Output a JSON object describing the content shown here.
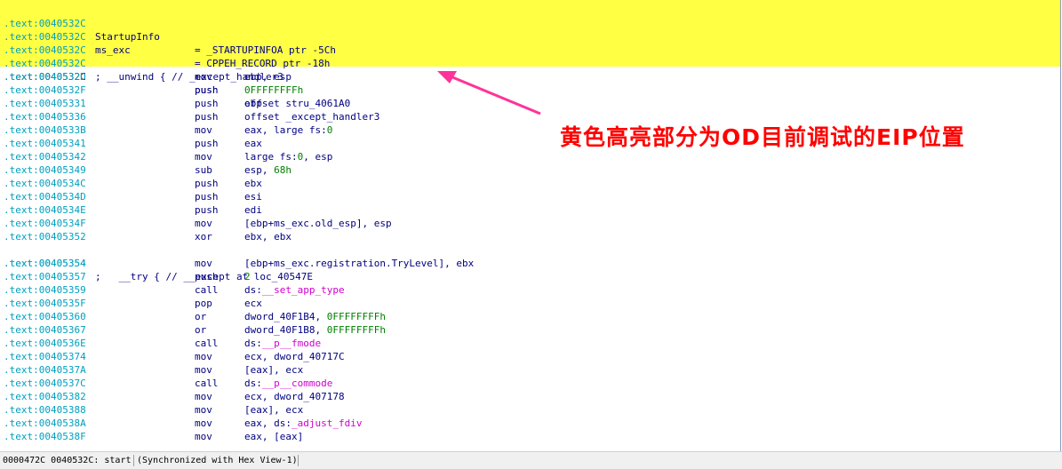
{
  "colors": {
    "highlight": "#ffff44",
    "address": "#00a0c0",
    "text": "#000080",
    "number": "#008000",
    "import": "#d000d0",
    "annotation": "#ff0000"
  },
  "listing": {
    "decls": [
      {
        "addr": ".text:0040532C",
        "name": "StartupInfo",
        "def": "= _STARTUPINFOA ptr -5Ch"
      },
      {
        "addr": ".text:0040532C",
        "name": "ms_exc",
        "def": "= CPPEH_RECORD ptr -18h"
      }
    ],
    "blank1": ".text:0040532C",
    "unwind": {
      "addr": ".text:0040532C",
      "comment": "; __unwind { // _except_handler3"
    },
    "current": {
      "addr": ".text:0040532C",
      "mnem": "push",
      "ops": "ebp"
    },
    "rows": [
      {
        "addr": ".text:0040532D",
        "mnem": "mov",
        "ops": "ebp, esp"
      },
      {
        "addr": ".text:0040532F",
        "mnem": "push",
        "ops": "0FFFFFFFFh"
      },
      {
        "addr": ".text:00405331",
        "mnem": "push",
        "ops": "offset stru_4061A0"
      },
      {
        "addr": ".text:00405336",
        "mnem": "push",
        "ops": "offset _except_handler3"
      },
      {
        "addr": ".text:0040533B",
        "mnem": "mov",
        "ops": "eax, large fs:0"
      },
      {
        "addr": ".text:00405341",
        "mnem": "push",
        "ops": "eax"
      },
      {
        "addr": ".text:00405342",
        "mnem": "mov",
        "ops": "large fs:0, esp"
      },
      {
        "addr": ".text:00405349",
        "mnem": "sub",
        "ops": "esp, 68h"
      },
      {
        "addr": ".text:0040534C",
        "mnem": "push",
        "ops": "ebx"
      },
      {
        "addr": ".text:0040534D",
        "mnem": "push",
        "ops": "esi"
      },
      {
        "addr": ".text:0040534E",
        "mnem": "push",
        "ops": "edi"
      },
      {
        "addr": ".text:0040534F",
        "mnem": "mov",
        "ops": "[ebp+ms_exc.old_esp], esp"
      },
      {
        "addr": ".text:00405352",
        "mnem": "xor",
        "ops": "ebx, ebx"
      }
    ],
    "try": {
      "addr": ".text:00405354",
      "comment": ";   __try { // __except at loc_40547E"
    },
    "rows2": [
      {
        "addr": ".text:00405354",
        "mnem": "mov",
        "ops": "[ebp+ms_exc.registration.TryLevel], ebx"
      },
      {
        "addr": ".text:00405357",
        "mnem": "push",
        "ops": "2"
      },
      {
        "addr": ".text:00405359",
        "mnem": "call",
        "pre": "ds:",
        "fn": "__set_app_type"
      },
      {
        "addr": ".text:0040535F",
        "mnem": "pop",
        "ops": "ecx"
      },
      {
        "addr": ".text:00405360",
        "mnem": "or",
        "ops": "dword_40F1B4, 0FFFFFFFFh"
      },
      {
        "addr": ".text:00405367",
        "mnem": "or",
        "ops": "dword_40F1B8, 0FFFFFFFFh"
      },
      {
        "addr": ".text:0040536E",
        "mnem": "call",
        "pre": "ds:",
        "fn": "__p__fmode"
      },
      {
        "addr": ".text:00405374",
        "mnem": "mov",
        "ops": "ecx, dword_40717C"
      },
      {
        "addr": ".text:0040537A",
        "mnem": "mov",
        "ops": "[eax], ecx"
      },
      {
        "addr": ".text:0040537C",
        "mnem": "call",
        "pre": "ds:",
        "fn": "__p__commode"
      },
      {
        "addr": ".text:00405382",
        "mnem": "mov",
        "ops": "ecx, dword_407178"
      },
      {
        "addr": ".text:00405388",
        "mnem": "mov",
        "ops": "[eax], ecx"
      },
      {
        "addr": ".text:0040538A",
        "mnem": "mov",
        "pre": "eax, ds:",
        "fn": "_adjust_fdiv"
      },
      {
        "addr": ".text:0040538F",
        "mnem": "mov",
        "ops": "eax, [eax]"
      }
    ]
  },
  "status": {
    "position": "0000472C 0040532C: start",
    "sync": "(Synchronized with Hex View-1)"
  },
  "annotation": {
    "text": "黄色高亮部分为OD目前调试的EIP位置"
  }
}
